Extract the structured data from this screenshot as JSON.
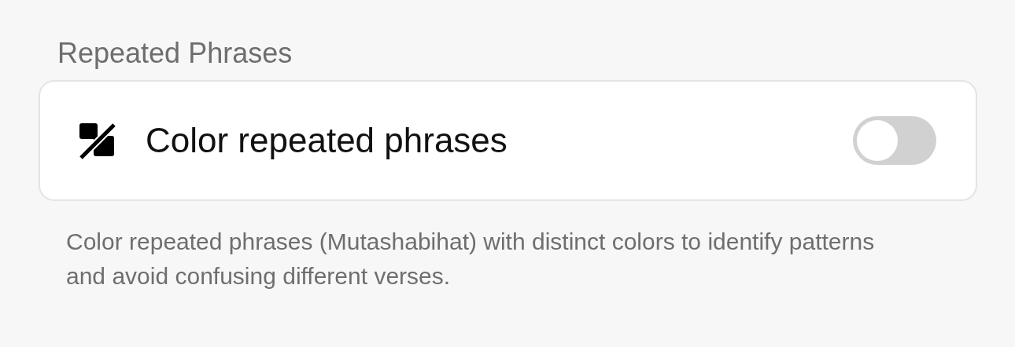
{
  "section": {
    "title": "Repeated Phrases"
  },
  "setting": {
    "label": "Color repeated phrases",
    "on": false
  },
  "description": "Color repeated phrases (Mutashabihat) with distinct colors to identify patterns and avoid confusing different verses."
}
